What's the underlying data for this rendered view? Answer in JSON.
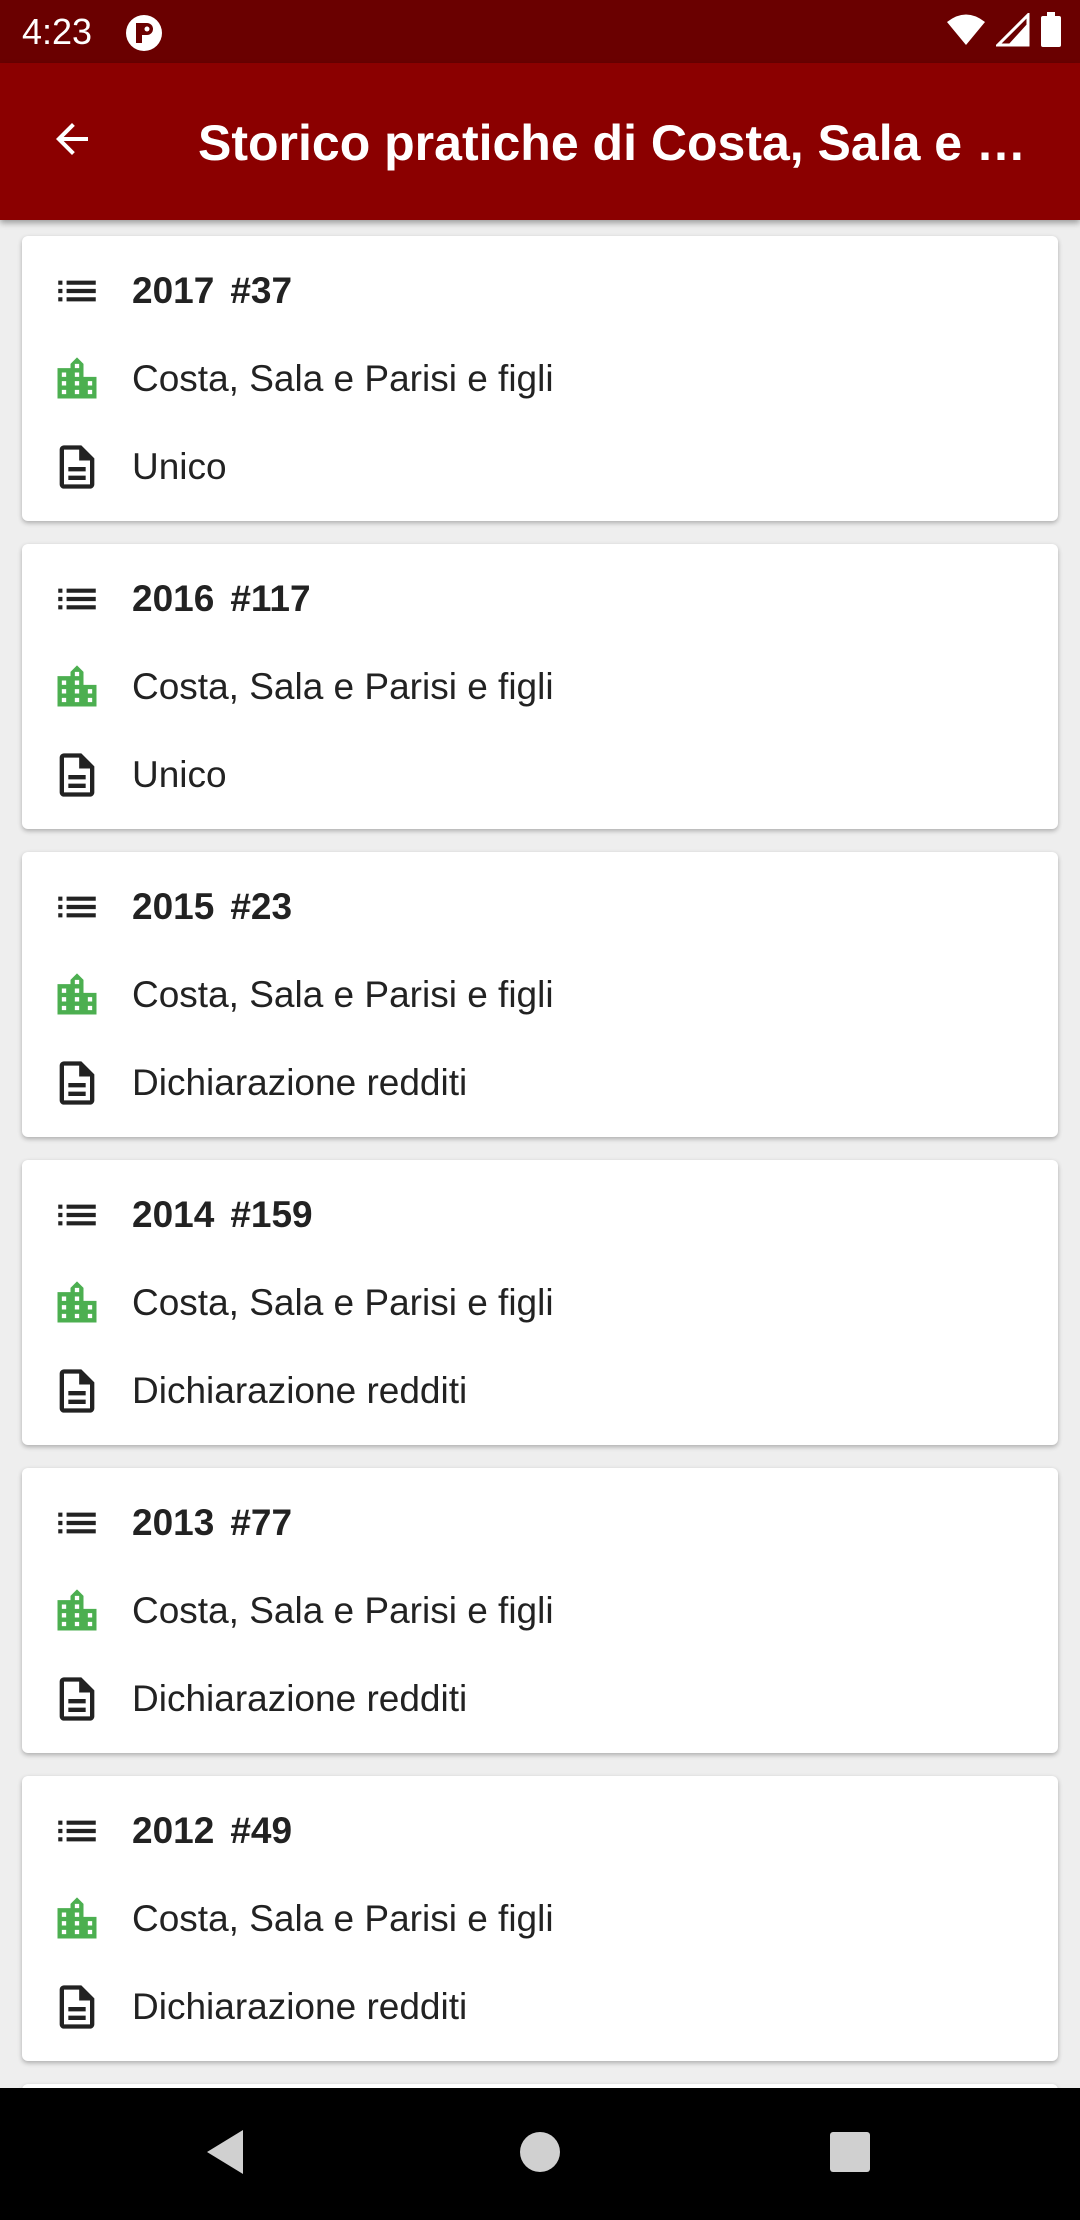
{
  "status_bar": {
    "time": "4:23",
    "icons": [
      "app-notification-icon",
      "wifi-icon",
      "signal-icon",
      "battery-icon"
    ]
  },
  "app_bar": {
    "title": "Storico pratiche di Costa, Sala e Parisi e figli",
    "back_icon": "arrow-back-icon",
    "background": "#8b0000"
  },
  "colors": {
    "status_bar": "#6a0000",
    "app_bar": "#8b0000",
    "company_icon": "#4caf50",
    "text": "#222222",
    "background": "#eeeeee"
  },
  "records": [
    {
      "year": "2017",
      "number": "#37",
      "company": "Costa, Sala e Parisi e figli",
      "type": "Unico"
    },
    {
      "year": "2016",
      "number": "#117",
      "company": "Costa, Sala e Parisi e figli",
      "type": "Unico"
    },
    {
      "year": "2015",
      "number": "#23",
      "company": "Costa, Sala e Parisi e figli",
      "type": "Dichiarazione redditi"
    },
    {
      "year": "2014",
      "number": "#159",
      "company": "Costa, Sala e Parisi e figli",
      "type": "Dichiarazione redditi"
    },
    {
      "year": "2013",
      "number": "#77",
      "company": "Costa, Sala e Parisi e figli",
      "type": "Dichiarazione redditi"
    },
    {
      "year": "2012",
      "number": "#49",
      "company": "Costa, Sala e Parisi e figli",
      "type": "Dichiarazione redditi"
    }
  ],
  "nav_bar": {
    "icons": [
      "nav-back-icon",
      "nav-home-icon",
      "nav-recents-icon"
    ]
  }
}
